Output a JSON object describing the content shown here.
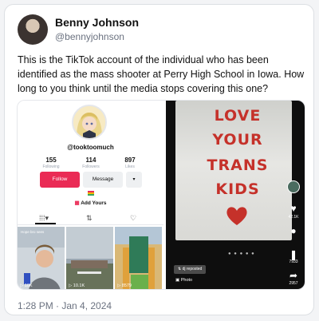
{
  "tweet": {
    "author_name": "Benny Johnson",
    "author_handle": "@bennyjohnson",
    "text": "This is the TikTok account of the individual who has been identified as the mass shooter at Perry High School in Iowa. How long to you think until the media stops covering this one?",
    "timestamp": "1:28 PM · Jan 4, 2024"
  },
  "tiktok_profile": {
    "username": "@tooktoomuch",
    "stats": [
      {
        "value": "155",
        "label": "Following"
      },
      {
        "value": "114",
        "label": "Followers"
      },
      {
        "value": "897",
        "label": "Likes"
      }
    ],
    "follow_label": "Follow",
    "message_label": "Message",
    "more_label": "▾",
    "add_yours_label": "Add Yours",
    "thumbnails": [
      {
        "views": "▷ 10K",
        "caption": "Hope bro sees"
      },
      {
        "views": "▷ 10.1K",
        "caption": ""
      },
      {
        "views": "▷ 8579",
        "caption": ""
      }
    ]
  },
  "tiktok_video": {
    "graffiti_lines": [
      "LOVE",
      "YOUR",
      "TRANS",
      "KIDS"
    ],
    "reposted_label": "dj reposted",
    "photo_label": "Photo",
    "side_counts": [
      "42.1K",
      "",
      "7933",
      "2957"
    ]
  },
  "colors": {
    "tiktok_red": "#ea2b55",
    "graffiti_red": "#c5312a"
  },
  "icons": [
    "avatar",
    "heart-icon",
    "comment-icon",
    "bookmark-icon",
    "share-icon",
    "grid-icon",
    "repost-icon",
    "liked-icon"
  ]
}
